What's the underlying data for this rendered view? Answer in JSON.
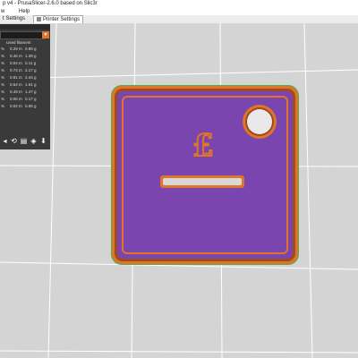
{
  "window": {
    "title": "p v4 - PrusaSlicer-2.6.0 based on Slic3r"
  },
  "menu": {
    "items": [
      "w",
      "Help"
    ]
  },
  "tabs": [
    {
      "label": "t Settings",
      "active": false
    },
    {
      "label": "Printer Settings",
      "active": true
    }
  ],
  "legend": {
    "header": "Used filament",
    "rows": [
      {
        "pct": "%",
        "time": "0.29 m",
        "weight": "0.89 g"
      },
      {
        "pct": "%",
        "time": "0.46 m",
        "weight": "1.39 g"
      },
      {
        "pct": "%",
        "time": "0.04 m",
        "weight": "0.11 g"
      },
      {
        "pct": "%",
        "time": "0.73 m",
        "weight": "2.17 g"
      },
      {
        "pct": "%",
        "time": "0.81 m",
        "weight": "2.44 g"
      },
      {
        "pct": "%",
        "time": "0.54 m",
        "weight": "1.61 g"
      },
      {
        "pct": "%",
        "time": "0.49 m",
        "weight": "1.47 g"
      },
      {
        "pct": "%",
        "time": "0.06 m",
        "weight": "0.17 g"
      },
      {
        "pct": "%",
        "time": "0.02 m",
        "weight": "0.06 g"
      }
    ]
  },
  "colors": {
    "accent": "#e07428",
    "infill": "#7b45b0",
    "perimeter": "#e07428",
    "perimeter_dark": "#a04a20",
    "skirt": "#4caf50",
    "bed": "#d2d2d2",
    "gridline": "#ffffff"
  },
  "model": {
    "symbol": "£"
  },
  "icons": [
    "select-icon",
    "rotate-icon",
    "layers-icon",
    "view-cube-icon",
    "down-arrow-icon"
  ]
}
